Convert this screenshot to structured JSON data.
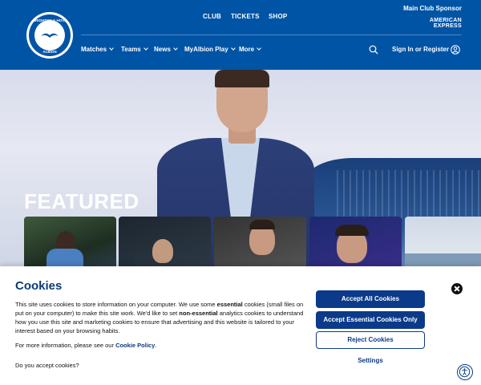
{
  "header": {
    "logo_text_top": "BRIGHTON & HOVE",
    "logo_text_bottom": "ALBION",
    "top_links": [
      "CLUB",
      "TICKETS",
      "SHOP"
    ],
    "sponsor_label": "Main Club Sponsor",
    "sponsor_name_line1": "AMERICAN",
    "sponsor_name_line2": "EXPRESS",
    "nav": [
      "Matches",
      "Teams",
      "News",
      "MyAlbion Play",
      "More"
    ],
    "signin_label": "Sign In or Register",
    "brand_color": "#0054a6"
  },
  "hero": {
    "section_title": "FEATURED"
  },
  "cookie": {
    "title": "Cookies",
    "body_1": "This site uses cookies to store information on your computer. We use some ",
    "body_bold_1": "essential",
    "body_2": " cookies (small files on put on your computer) to make this site work. We'd like to set ",
    "body_bold_2": "non-essential",
    "body_3": " analytics cookies to understand how you use this site and marketing cookies to ensure that advertising and this website is tailored to your interest based on your browsing habits.",
    "more_prefix": "For more information, please see our ",
    "policy_link": "Cookie Policy",
    "more_suffix": ".",
    "question": "Do you accept cookies?",
    "accept_all": "Accept All Cookies",
    "accept_essential": "Accept Essential Cookies Only",
    "reject": "Reject Cookies",
    "settings": "Settings",
    "accent_color": "#0b3a8a"
  }
}
